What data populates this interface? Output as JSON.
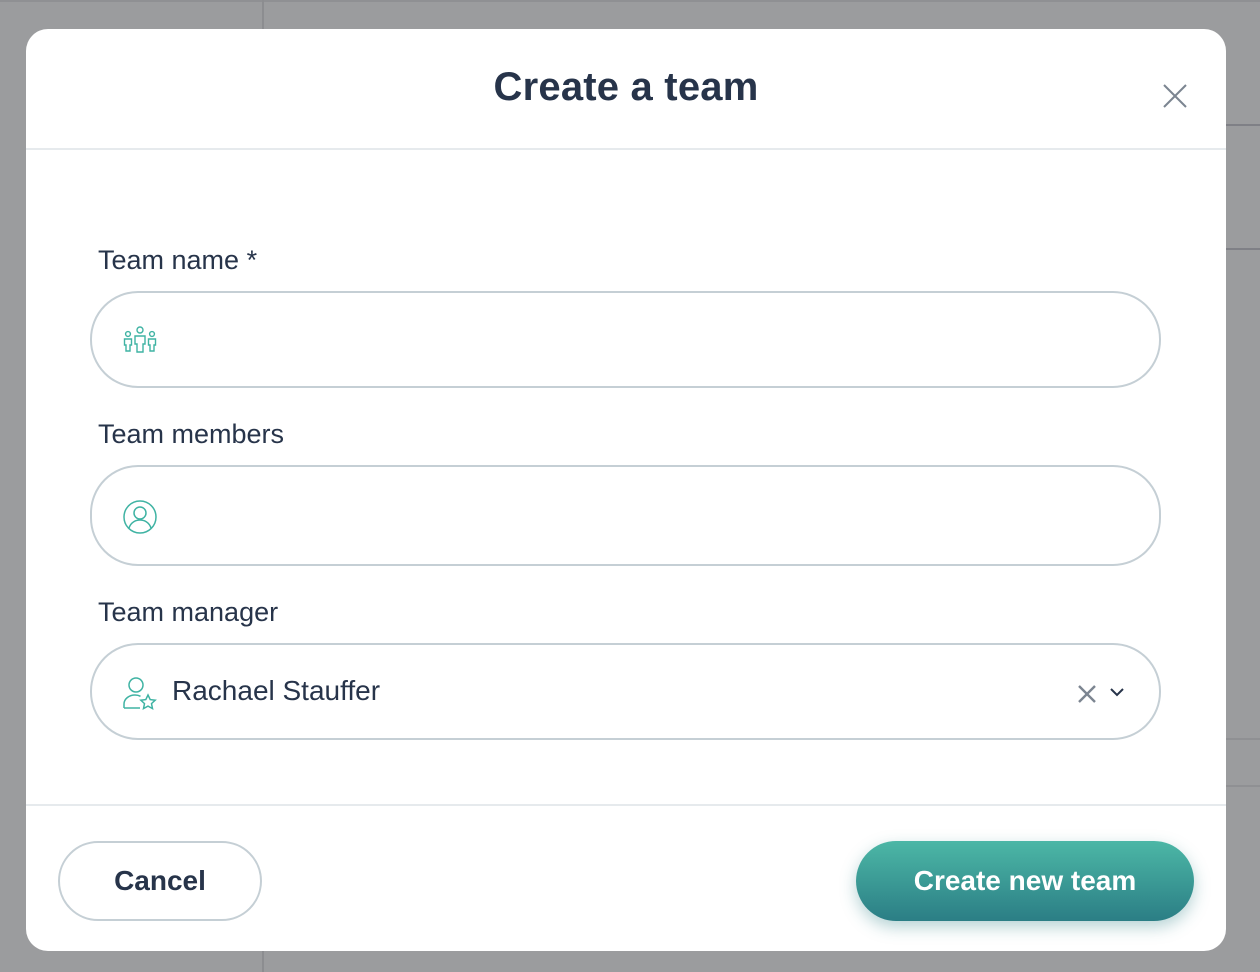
{
  "modal": {
    "title": "Create a team"
  },
  "fields": {
    "team_name": {
      "label": "Team name *",
      "value": "",
      "placeholder": ""
    },
    "team_members": {
      "label": "Team members",
      "value": "",
      "placeholder": ""
    },
    "team_manager": {
      "label": "Team manager",
      "selected": "Rachael Stauffer"
    }
  },
  "footer": {
    "cancel_label": "Cancel",
    "create_label": "Create new team"
  },
  "colors": {
    "accent": "#3fb3a3",
    "primary_button_top": "#4cb7a6",
    "primary_button_bottom": "#2b7e85",
    "text": "#27344a",
    "border": "#c5cfd5"
  },
  "icons": {
    "close": "close-icon",
    "team_name": "team-group-icon",
    "team_members": "user-circle-icon",
    "team_manager": "user-star-icon",
    "clear": "clear-icon",
    "dropdown": "chevron-down-icon"
  }
}
